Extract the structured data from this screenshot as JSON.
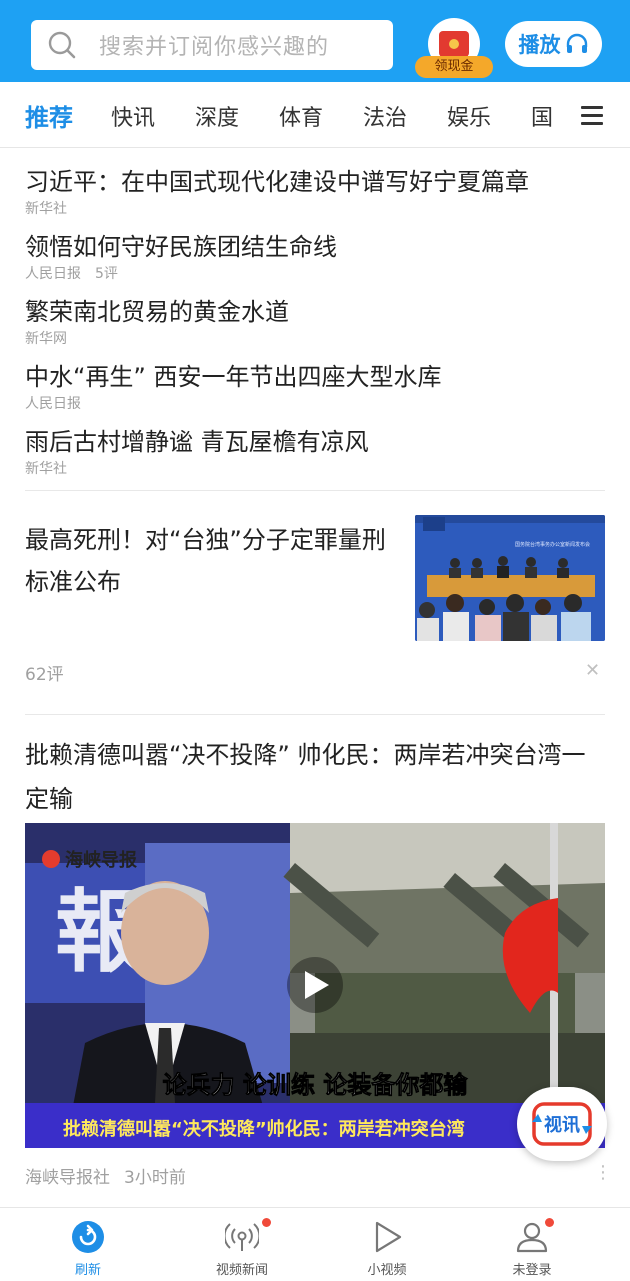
{
  "header": {
    "search_placeholder": "搜索并订阅你感兴趣的",
    "reward_label": "领现金",
    "play_label": "播放"
  },
  "tabs": [
    {
      "label": "推荐",
      "active": true
    },
    {
      "label": "快讯"
    },
    {
      "label": "深度"
    },
    {
      "label": "体育"
    },
    {
      "label": "法治"
    },
    {
      "label": "娱乐"
    },
    {
      "label": "国"
    }
  ],
  "top_news": [
    {
      "title": "习近平：在中国式现代化建设中谱写好宁夏篇章",
      "source": "新华社",
      "comments": ""
    },
    {
      "title": "领悟如何守好民族团结生命线",
      "source": "人民日报",
      "comments": "5评"
    },
    {
      "title": "繁荣南北贸易的黄金水道",
      "source": "新华网",
      "comments": ""
    },
    {
      "title": "中水“再生” 西安一年节出四座大型水库",
      "source": "人民日报",
      "comments": ""
    },
    {
      "title": "雨后古村增静谧 青瓦屋檐有凉风",
      "source": "新华社",
      "comments": ""
    }
  ],
  "article2": {
    "title": "最高死刑！对“台独”分子定罪量刑标准公布",
    "comments": "62评",
    "thumb_banner": "国务院台湾事务办公室新闻发布会"
  },
  "article3": {
    "title": "批赖清德叫嚣“决不投降” 帅化民：两岸若冲突台湾一定输",
    "video_logo": "海峡导报",
    "video_subtitle": "论兵力 论训练 论装备你都输",
    "video_ticker": "批赖清德叫嚣“决不投降”帅化民：两岸若冲突台湾",
    "source": "海峡导报社",
    "time": "3小时前"
  },
  "floating_button": "视讯",
  "bottom_nav": [
    {
      "label": "刷新",
      "icon": "refresh-icon",
      "active": true
    },
    {
      "label": "视频新闻",
      "icon": "broadcast-icon",
      "badge": true
    },
    {
      "label": "小视频",
      "icon": "play-icon"
    },
    {
      "label": "未登录",
      "icon": "user-icon",
      "badge": true
    }
  ],
  "colors": {
    "brand": "#1ea1f3",
    "accent": "#1e8ee6",
    "badge": "#f04a3a"
  }
}
